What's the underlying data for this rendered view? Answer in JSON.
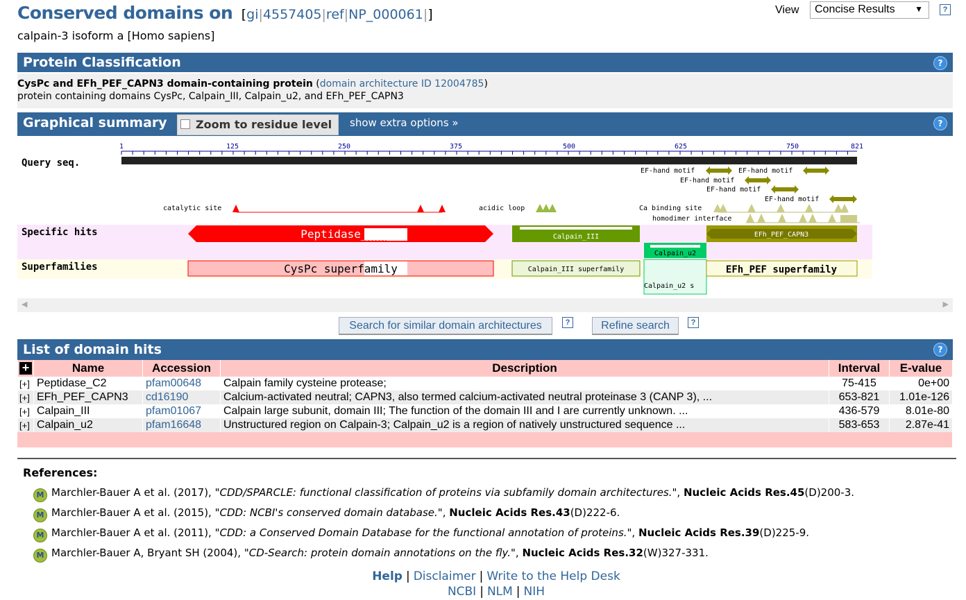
{
  "header": {
    "title": "Conserved domains on",
    "ids": [
      "gi",
      "4557405",
      "ref",
      "NP_000061"
    ],
    "subtitle": "calpain-3 isoform a [Homo sapiens]",
    "view_label": "View",
    "view_selected": "Concise Results",
    "help_glyph": "?"
  },
  "classification": {
    "bar_title": "Protein Classification",
    "name": "CysPc and EFh_PEF_CAPN3 domain-containing protein",
    "arch_link": "domain architecture ID 12004785",
    "description": "protein containing domains CysPc, Calpain_III, Calpain_u2, and EFh_PEF_CAPN3"
  },
  "graphical": {
    "bar_title": "Graphical summary",
    "zoom_label": "Zoom to residue level",
    "extra_options": "show extra options »",
    "query_label": "Query seq.",
    "ruler_ticks": [
      "1",
      "125",
      "250",
      "375",
      "500",
      "625",
      "750",
      "821"
    ],
    "features": {
      "ef1": "EF-hand motif",
      "ef2": "EF-hand motif",
      "ef3": "EF-hand motif",
      "ef4": "EF-hand motif",
      "ef5": "EF-hand motif",
      "catalytic": "catalytic site",
      "acidic": "acidic loop",
      "ca_binding": "Ca binding site",
      "homodimer": "homodimer interface"
    },
    "row_labels": {
      "specific": "Specific hits",
      "superfamilies": "Superfamilies"
    },
    "domains": {
      "peptidase": "Peptidase_C2",
      "calpain3": "Calpain_III",
      "calpain_u2": "Calpain_u2",
      "efh": "EFh_PEF_CAPN3",
      "cyspc_sf": "CysPc superfamily",
      "calpain3_sf": "Calpain_III superfamily",
      "calpain_u2_sf": "Calpain_u2 s",
      "efh_sf": "EFh_PEF superfamily"
    },
    "colors": {
      "peptidase": "#ff0000",
      "calpain3": "#669900",
      "calpain_u2": "#00cc66",
      "efh": "#999900",
      "bar": "#336699",
      "table_header": "#ffc6c6"
    }
  },
  "buttons": {
    "search_similar": "Search for similar domain architectures",
    "refine": "Refine search"
  },
  "hits": {
    "bar_title": "List of domain hits",
    "expand_all": "+",
    "columns": [
      "Name",
      "Accession",
      "Description",
      "Interval",
      "E-value"
    ],
    "rows": [
      {
        "expand": "[+]",
        "name": "Peptidase_C2",
        "accession": "pfam00648",
        "description": "Calpain family cysteine protease;",
        "interval": "75-415",
        "evalue": "0e+00"
      },
      {
        "expand": "[+]",
        "name": "EFh_PEF_CAPN3",
        "accession": "cd16190",
        "description": "Calcium-activated neutral; CAPN3, also termed calcium-activated neutral proteinase 3 (CANP 3), ...",
        "interval": "653-821",
        "evalue": "1.01e-126"
      },
      {
        "expand": "[+]",
        "name": "Calpain_III",
        "accession": "pfam01067",
        "description": "Calpain large subunit, domain III; The function of the domain III and I are currently unknown. ...",
        "interval": "436-579",
        "evalue": "8.01e-80"
      },
      {
        "expand": "[+]",
        "name": "Calpain_u2",
        "accession": "pfam16648",
        "description": "Unstructured region on Calpain-3; Calpain_u2 is a region of natively unstructured sequence ...",
        "interval": "583-653",
        "evalue": "2.87e-41"
      }
    ]
  },
  "references": {
    "title": "References:",
    "icon": "M",
    "items": [
      {
        "authors": "Marchler-Bauer A et al. (2017),",
        "title": "\"CDD/SPARCLE: functional classification of proteins via subfamily domain architectures.\"",
        "journal": "Nucleic Acids Res.",
        "vol": "45",
        "pages": "(D)200-3."
      },
      {
        "authors": "Marchler-Bauer A et al. (2015),",
        "title": "\"CDD: NCBI's conserved domain database.\"",
        "journal": "Nucleic Acids Res.",
        "vol": "43",
        "pages": "(D)222-6."
      },
      {
        "authors": "Marchler-Bauer A et al. (2011),",
        "title": "\"CDD: a Conserved Domain Database for the functional annotation of proteins.\"",
        "journal": "Nucleic Acids Res.",
        "vol": "39",
        "pages": "(D)225-9."
      },
      {
        "authors": "Marchler-Bauer A, Bryant SH (2004),",
        "title": "\"CD-Search: protein domain annotations on the fly.\"",
        "journal": "Nucleic Acids Res.",
        "vol": "32",
        "pages": "(W)327-331."
      }
    ]
  },
  "footer": {
    "help": "Help",
    "disclaimer": "Disclaimer",
    "helpdesk": "Write to the Help Desk",
    "ncbi": "NCBI",
    "nlm": "NLM",
    "nih": "NIH",
    "sep": "|"
  }
}
